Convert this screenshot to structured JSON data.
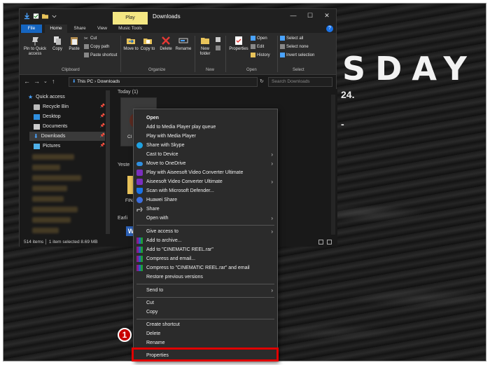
{
  "background_brand": {
    "letters": "SDAY",
    "line2": "24.",
    "line3": "-"
  },
  "window": {
    "title": "Downloads",
    "contextual_tab": "Play",
    "contextual_group": "Music Tools",
    "controls": {
      "minimize": "—",
      "maximize": "☐",
      "close": "✕"
    }
  },
  "tabs": [
    "File",
    "Home",
    "Share",
    "View",
    "Music Tools"
  ],
  "ribbon": {
    "clipboard": {
      "pin": "Pin to Quick access",
      "copy": "Copy",
      "paste": "Paste",
      "cut": "Cut",
      "copy_path": "Copy path",
      "paste_shortcut": "Paste shortcut",
      "label": "Clipboard"
    },
    "organize": {
      "move_to": "Move to",
      "copy_to": "Copy to",
      "delete": "Delete",
      "rename": "Rename",
      "label": "Organize"
    },
    "new": {
      "new_folder": "New folder",
      "label": "New"
    },
    "open": {
      "properties": "Properties",
      "open": "Open",
      "edit": "Edit",
      "history": "History",
      "label": "Open"
    },
    "select": {
      "select_all": "Select all",
      "select_none": "Select none",
      "invert": "Invert selection",
      "label": "Select"
    }
  },
  "address": {
    "crumbs": "This PC  ›  Downloads",
    "search_placeholder": "Search Downloads"
  },
  "sidebar": {
    "items": [
      {
        "label": "Quick access"
      },
      {
        "label": "Recycle Bin"
      },
      {
        "label": "Desktop"
      },
      {
        "label": "Documents"
      },
      {
        "label": "Downloads"
      },
      {
        "label": "Pictures"
      }
    ]
  },
  "content": {
    "groups": [
      "Today (1)",
      "Yeste",
      "Earli"
    ],
    "file_labels": [
      "CI",
      "FINA"
    ]
  },
  "status": {
    "text": "514 items  │  1 item selected  8.69 MB"
  },
  "context_menu": {
    "items": [
      {
        "label": "Open",
        "bold": true
      },
      {
        "label": "Add to Media Player play queue"
      },
      {
        "label": "Play with Media Player"
      },
      {
        "label": "Share with Skype"
      },
      {
        "label": "Cast to Device",
        "submenu": true
      },
      {
        "label": "Move to OneDrive",
        "submenu": true
      },
      {
        "label": "Play with Aiseesoft Video Converter Ultimate"
      },
      {
        "label": "Aiseesoft Video Converter Ultimate",
        "submenu": true
      },
      {
        "label": "Scan with Microsoft Defender..."
      },
      {
        "label": "Huawei Share"
      },
      {
        "label": "Share"
      },
      {
        "label": "Open with",
        "submenu": true
      },
      {
        "label": "Give access to",
        "submenu": true
      },
      {
        "label": "Add to archive..."
      },
      {
        "label": "Add to \"CINEMATIC REEL.rar\""
      },
      {
        "label": "Compress and email..."
      },
      {
        "label": "Compress to \"CINEMATIC REEL.rar\" and email"
      },
      {
        "label": "Restore previous versions"
      },
      {
        "label": "Send to",
        "submenu": true
      },
      {
        "label": "Cut"
      },
      {
        "label": "Copy"
      },
      {
        "label": "Create shortcut"
      },
      {
        "label": "Delete"
      },
      {
        "label": "Rename"
      },
      {
        "label": "Properties"
      }
    ],
    "arrow_glyph": "›"
  },
  "annotation": {
    "step_number": "1",
    "highlight_color": "#e00000"
  },
  "colors": {
    "file_tab": "#1565c0",
    "play_tab": "#f4e783",
    "menu_bg": "#2b2b2b",
    "window_bg": "#191919"
  }
}
